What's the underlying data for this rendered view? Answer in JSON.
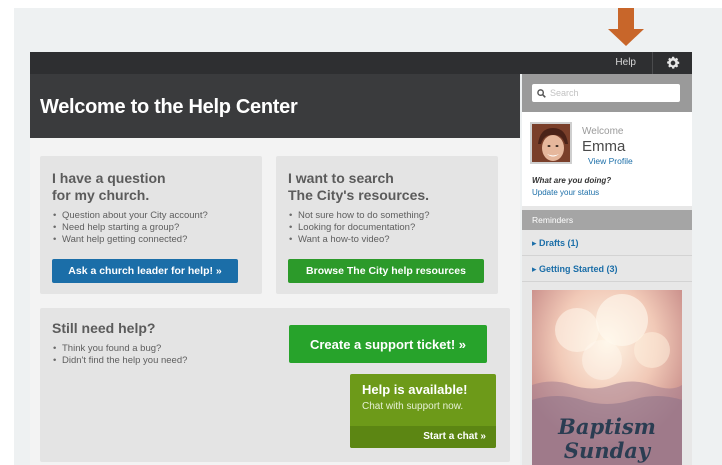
{
  "header": {
    "help_link": "Help",
    "settings_icon": "gear-icon"
  },
  "banner": {
    "title": "Welcome to the Help Center"
  },
  "cards": {
    "church": {
      "title_line1": "I have a question",
      "title_line2": "for my church.",
      "bullets": [
        "Question about your City account?",
        "Need help starting a group?",
        "Want help getting connected?"
      ],
      "button": "Ask a church leader for help! »"
    },
    "search": {
      "title_line1": "I want to search",
      "title_line2": "The City's resources.",
      "bullets": [
        "Not sure how to do something?",
        "Looking for documentation?",
        "Want a how-to video?"
      ],
      "button": "Browse The City help resources"
    },
    "still": {
      "title": "Still need help?",
      "bullets": [
        "Think you found a bug?",
        "Didn't find the help you need?"
      ],
      "ticket_button": "Create a support ticket! »",
      "chat": {
        "title": "Help is available!",
        "subtitle": "Chat with support now.",
        "start": "Start a chat »"
      }
    }
  },
  "sidebar": {
    "search_placeholder": "Search",
    "profile": {
      "welcome": "Welcome",
      "name": "Emma",
      "view_profile": "View Profile",
      "status_question": "What are you doing?",
      "status_link": "Update your status"
    },
    "reminders": {
      "title": "Reminders",
      "items": [
        {
          "label": "Drafts (1)"
        },
        {
          "label": "Getting Started (3)"
        }
      ]
    },
    "promo": {
      "line1": "Baptism",
      "line2": "Sunday"
    }
  },
  "colors": {
    "accent_blue": "#1b6ea8",
    "accent_green": "#2c9a2a",
    "chat_green": "#6d9a19",
    "arrow_orange": "#c8662a",
    "topbar_dark": "#2e2f31"
  }
}
